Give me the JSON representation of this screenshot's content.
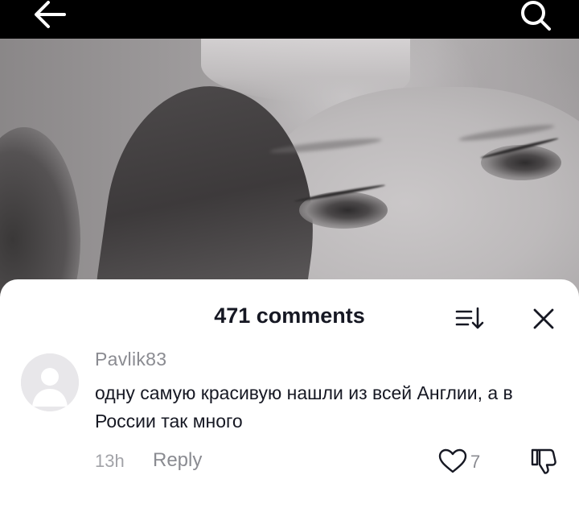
{
  "top_bar": {
    "back_icon": "arrow-left-icon",
    "search_icon": "search-icon"
  },
  "comments_panel": {
    "title": "471 comments",
    "sort_icon": "sort-icon",
    "close_icon": "close-icon"
  },
  "comment": {
    "username": "Pavlik83",
    "text": "одну самую красивую нашли из всей Англии, а в России так много",
    "time": "13h",
    "reply_label": "Reply",
    "like_count": "7",
    "avatar_icon": "default-avatar-icon",
    "like_icon": "heart-outline-icon",
    "dislike_icon": "thumbs-down-icon"
  },
  "colors": {
    "sheet_background": "#ffffff",
    "primary_text": "#161823",
    "secondary_text": "#8a8b91",
    "avatar_background": "#e8e7ea"
  }
}
